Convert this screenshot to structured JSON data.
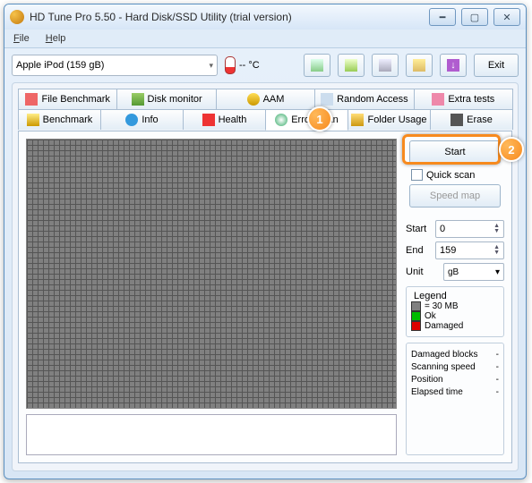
{
  "window": {
    "title": "HD Tune Pro 5.50 - Hard Disk/SSD Utility (trial version)"
  },
  "menubar": {
    "file": "File",
    "help": "Help"
  },
  "toolbar": {
    "device_selected": "Apple   iPod (159 gB)",
    "temp": "-- °C",
    "exit": "Exit"
  },
  "tabs": {
    "row1": [
      {
        "label": "File Benchmark"
      },
      {
        "label": "Disk monitor"
      },
      {
        "label": "AAM"
      },
      {
        "label": "Random Access"
      },
      {
        "label": "Extra tests"
      }
    ],
    "row2": [
      {
        "label": "Benchmark"
      },
      {
        "label": "Info"
      },
      {
        "label": "Health"
      },
      {
        "label": "Error Scan"
      },
      {
        "label": "Folder Usage"
      },
      {
        "label": "Erase"
      }
    ],
    "active": "Error Scan"
  },
  "scan": {
    "start_btn": "Start",
    "quick_scan": "Quick scan",
    "speed_map": "Speed map",
    "start_label": "Start",
    "start_val": "0",
    "end_label": "End",
    "end_val": "159",
    "unit_label": "Unit",
    "unit_val": "gB"
  },
  "legend": {
    "title": "Legend",
    "size": "= 30 MB",
    "ok": "Ok",
    "damaged": "Damaged"
  },
  "stats": {
    "damaged_blocks": {
      "label": "Damaged blocks",
      "value": "-"
    },
    "scanning_speed": {
      "label": "Scanning speed",
      "value": "-"
    },
    "position": {
      "label": "Position",
      "value": "-"
    },
    "elapsed": {
      "label": "Elapsed time",
      "value": "-"
    }
  },
  "callouts": {
    "one": "1",
    "two": "2"
  }
}
